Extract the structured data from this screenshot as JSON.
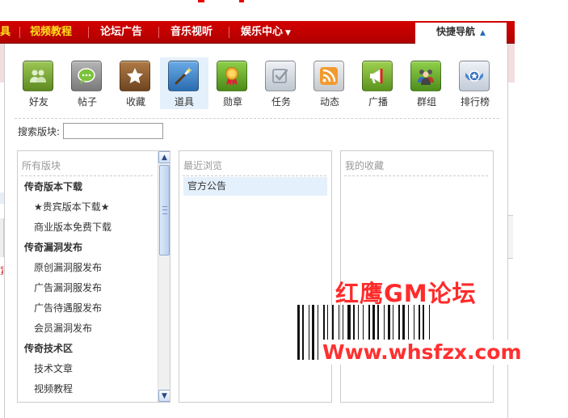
{
  "background": {
    "nav": [
      {
        "label": "具",
        "active": true
      },
      {
        "label": "视频教程",
        "active": true
      },
      {
        "label": "论坛广告",
        "active": false
      },
      {
        "label": "音乐视听",
        "active": false
      },
      {
        "label": "娱乐中心",
        "active": false,
        "dropdown": true
      }
    ],
    "quick_nav_label": "快捷导航",
    "left_fragment": "紧"
  },
  "icons": [
    {
      "label": "好友",
      "icon": "friends-icon",
      "color": "#6e9a2b"
    },
    {
      "label": "帖子",
      "icon": "post-icon",
      "color": "#8a8a8a"
    },
    {
      "label": "收藏",
      "icon": "favorite-star-icon",
      "color": "#8a5a2c"
    },
    {
      "label": "道具",
      "icon": "magic-wand-icon",
      "color": "#3b7fc1",
      "active": true
    },
    {
      "label": "勋章",
      "icon": "medal-icon",
      "color": "#5fa02a"
    },
    {
      "label": "任务",
      "icon": "task-check-icon",
      "color": "#c8cdd4"
    },
    {
      "label": "动态",
      "icon": "rss-feed-icon",
      "color": "#c9ccd1"
    },
    {
      "label": "广播",
      "icon": "megaphone-icon",
      "color": "#6ea52a"
    },
    {
      "label": "群组",
      "icon": "group-icon",
      "color": "#5a9e2a"
    },
    {
      "label": "排行榜",
      "icon": "ranking-badge-icon",
      "color": "#c8d0dc"
    }
  ],
  "search": {
    "label": "搜索版块:",
    "value": "",
    "placeholder": ""
  },
  "all_forums": {
    "title": "所有版块",
    "items": [
      {
        "label": "传奇版本下载",
        "type": "cat"
      },
      {
        "label": "★贵宾版本下载★",
        "type": "sub"
      },
      {
        "label": "商业版本免费下载",
        "type": "sub"
      },
      {
        "label": "传奇漏洞发布",
        "type": "cat"
      },
      {
        "label": "原创漏洞服发布",
        "type": "sub"
      },
      {
        "label": "广告漏洞服发布",
        "type": "sub"
      },
      {
        "label": "广告待遇服发布",
        "type": "sub"
      },
      {
        "label": "会员漏洞发布",
        "type": "sub"
      },
      {
        "label": "传奇技术区",
        "type": "cat"
      },
      {
        "label": "技术文章",
        "type": "sub"
      },
      {
        "label": "视频教程",
        "type": "sub"
      }
    ]
  },
  "recent": {
    "title": "最近浏览",
    "items": [
      "官方公告"
    ]
  },
  "favorites": {
    "title": "我的收藏",
    "items": []
  },
  "watermark": {
    "title": "红鹰GM论坛",
    "url": "Www.whsfzx.com"
  }
}
